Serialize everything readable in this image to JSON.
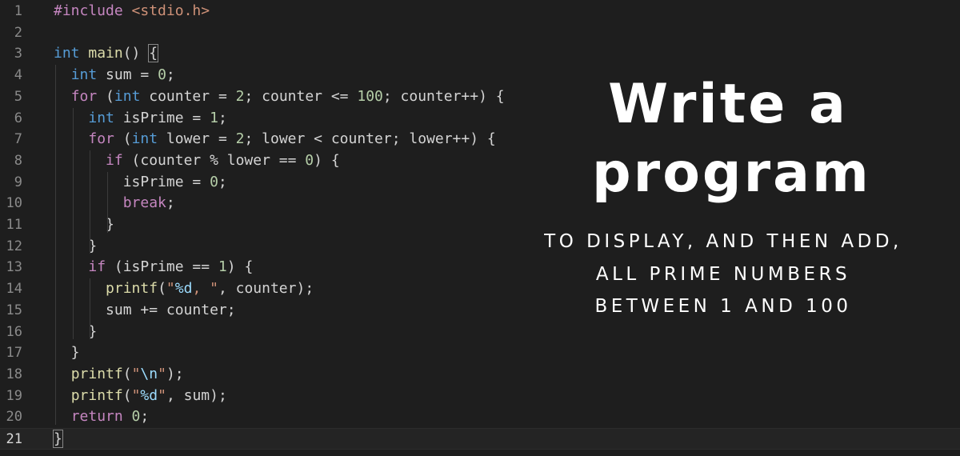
{
  "editor": {
    "active_line": 21,
    "lines": [
      {
        "n": "1",
        "tokens": [
          [
            "pp",
            "#include "
          ],
          [
            "inc",
            "<stdio.h>"
          ]
        ]
      },
      {
        "n": "2",
        "tokens": []
      },
      {
        "n": "3",
        "tokens": [
          [
            "ty",
            "int "
          ],
          [
            "fn",
            "main"
          ],
          [
            "id",
            "() "
          ],
          [
            "id",
            "{"
          ]
        ]
      },
      {
        "n": "4",
        "tokens": [
          [
            "id",
            "  "
          ],
          [
            "ty",
            "int "
          ],
          [
            "id",
            "sum = "
          ],
          [
            "num",
            "0"
          ],
          [
            "id",
            ";"
          ]
        ]
      },
      {
        "n": "5",
        "tokens": [
          [
            "id",
            "  "
          ],
          [
            "kw",
            "for "
          ],
          [
            "id",
            "("
          ],
          [
            "ty",
            "int "
          ],
          [
            "id",
            "counter = "
          ],
          [
            "num",
            "2"
          ],
          [
            "id",
            "; counter <= "
          ],
          [
            "num",
            "100"
          ],
          [
            "id",
            "; counter++) {"
          ]
        ]
      },
      {
        "n": "6",
        "tokens": [
          [
            "id",
            "    "
          ],
          [
            "ty",
            "int "
          ],
          [
            "id",
            "isPrime = "
          ],
          [
            "num",
            "1"
          ],
          [
            "id",
            ";"
          ]
        ]
      },
      {
        "n": "7",
        "tokens": [
          [
            "id",
            "    "
          ],
          [
            "kw",
            "for "
          ],
          [
            "id",
            "("
          ],
          [
            "ty",
            "int "
          ],
          [
            "id",
            "lower = "
          ],
          [
            "num",
            "2"
          ],
          [
            "id",
            "; lower < counter; lower++) {"
          ]
        ]
      },
      {
        "n": "8",
        "tokens": [
          [
            "id",
            "      "
          ],
          [
            "kw",
            "if "
          ],
          [
            "id",
            "(counter % lower == "
          ],
          [
            "num",
            "0"
          ],
          [
            "id",
            ") {"
          ]
        ]
      },
      {
        "n": "9",
        "tokens": [
          [
            "id",
            "        isPrime = "
          ],
          [
            "num",
            "0"
          ],
          [
            "id",
            ";"
          ]
        ]
      },
      {
        "n": "10",
        "tokens": [
          [
            "id",
            "        "
          ],
          [
            "kw",
            "break"
          ],
          [
            "id",
            ";"
          ]
        ]
      },
      {
        "n": "11",
        "tokens": [
          [
            "id",
            "      }"
          ]
        ]
      },
      {
        "n": "12",
        "tokens": [
          [
            "id",
            "    }"
          ]
        ]
      },
      {
        "n": "13",
        "tokens": [
          [
            "id",
            "    "
          ],
          [
            "kw",
            "if "
          ],
          [
            "id",
            "(isPrime == "
          ],
          [
            "num",
            "1"
          ],
          [
            "id",
            ") {"
          ]
        ]
      },
      {
        "n": "14",
        "tokens": [
          [
            "id",
            "      "
          ],
          [
            "fn",
            "printf"
          ],
          [
            "id",
            "("
          ],
          [
            "str",
            "\""
          ],
          [
            "fmt",
            "%d"
          ],
          [
            "str",
            ", \""
          ],
          [
            "id",
            ", counter);"
          ]
        ]
      },
      {
        "n": "15",
        "tokens": [
          [
            "id",
            "      sum += counter;"
          ]
        ]
      },
      {
        "n": "16",
        "tokens": [
          [
            "id",
            "    }"
          ]
        ]
      },
      {
        "n": "17",
        "tokens": [
          [
            "id",
            "  }"
          ]
        ]
      },
      {
        "n": "18",
        "tokens": [
          [
            "id",
            "  "
          ],
          [
            "fn",
            "printf"
          ],
          [
            "id",
            "("
          ],
          [
            "str",
            "\""
          ],
          [
            "fmt",
            "\\n"
          ],
          [
            "str",
            "\""
          ],
          [
            "id",
            ");"
          ]
        ]
      },
      {
        "n": "19",
        "tokens": [
          [
            "id",
            "  "
          ],
          [
            "fn",
            "printf"
          ],
          [
            "id",
            "("
          ],
          [
            "str",
            "\""
          ],
          [
            "fmt",
            "%d"
          ],
          [
            "str",
            "\""
          ],
          [
            "id",
            ", sum);"
          ]
        ]
      },
      {
        "n": "20",
        "tokens": [
          [
            "id",
            "  "
          ],
          [
            "kw",
            "return "
          ],
          [
            "num",
            "0"
          ],
          [
            "id",
            ";"
          ]
        ]
      },
      {
        "n": "21",
        "tokens": [
          [
            "id",
            "}"
          ]
        ]
      }
    ]
  },
  "headline": {
    "line1": "Write a",
    "line2": "program"
  },
  "subtitle": {
    "line1": "TO DISPLAY, AND THEN ADD,",
    "line2": "ALL PRIME NUMBERS",
    "line3": "BETWEEN 1 AND 100"
  },
  "colors": {
    "background": "#1e1e1e",
    "keyword": "#c586c0",
    "type": "#569cd6",
    "function": "#dcdcaa",
    "number": "#b5cea8",
    "string": "#ce9178",
    "escape": "#9cdcfe",
    "text": "#d4d4d4",
    "headline": "#ffffff"
  }
}
